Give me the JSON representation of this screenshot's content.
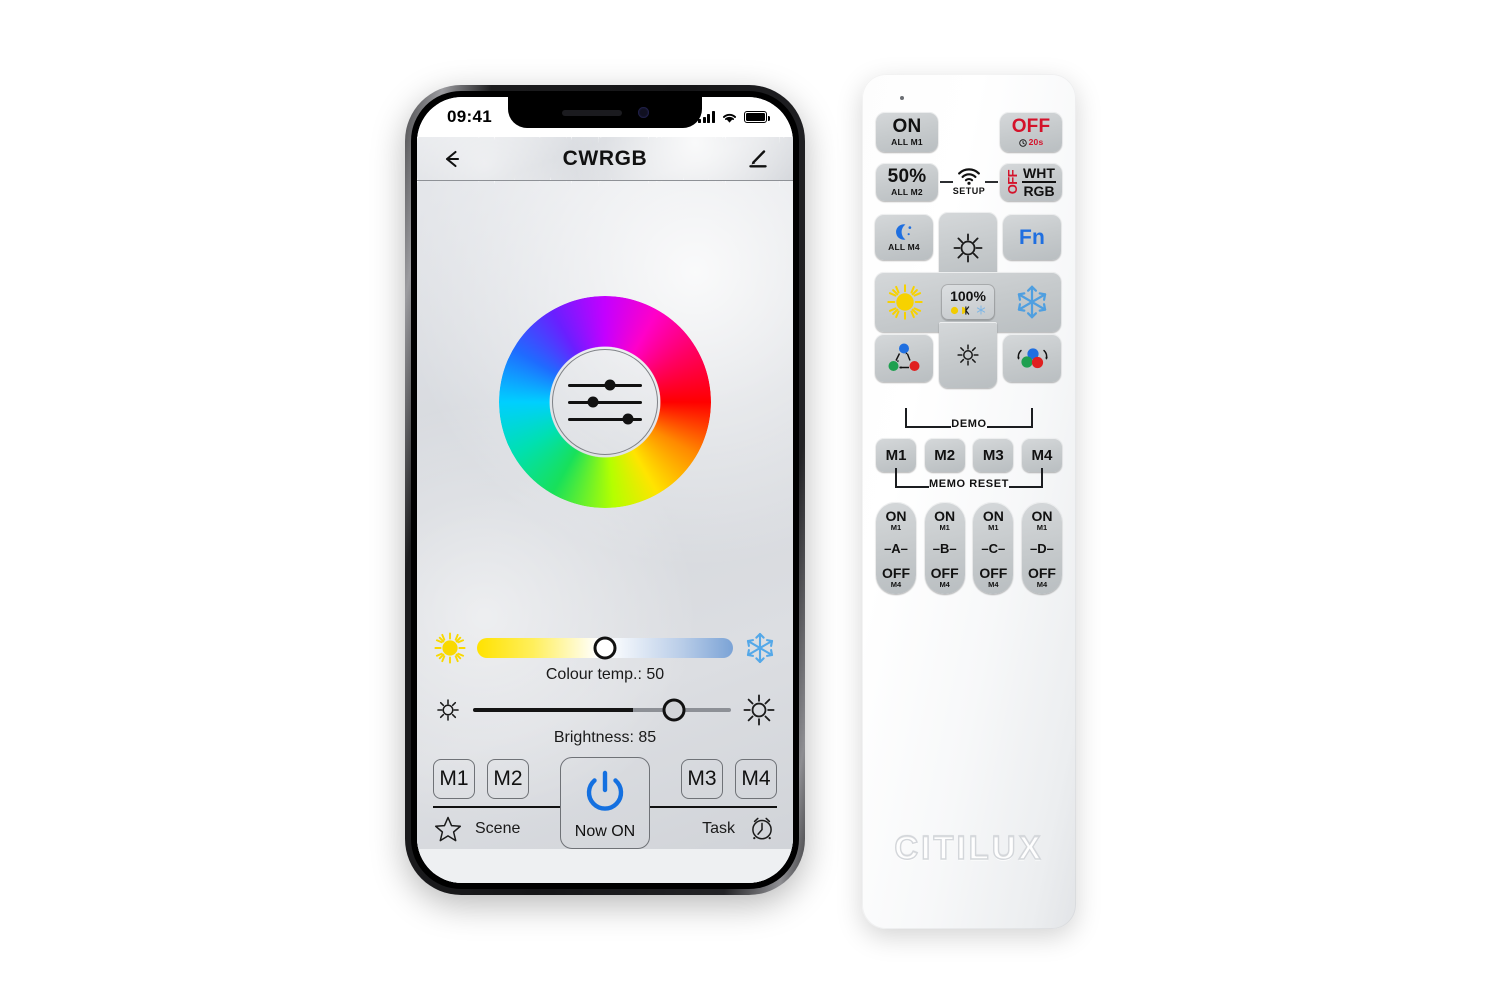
{
  "phone": {
    "status": {
      "time": "09:41",
      "signal_icon": "signal-bars-icon",
      "wifi_icon": "wifi-icon",
      "battery_icon": "battery-icon"
    },
    "header": {
      "back_icon": "back-arrow-icon",
      "title": "CWRGB",
      "edit_icon": "pencil-edit-icon"
    },
    "wheel": {
      "name": "colour-wheel",
      "center_icon": "sliders-icon"
    },
    "sliders": [
      {
        "id": "colour-temp",
        "left_icon": "warm-sun-icon",
        "right_icon": "snowflake-icon",
        "label": "Colour temp.: 50",
        "value": 50,
        "min": 0,
        "max": 100
      },
      {
        "id": "brightness",
        "left_icon": "low-brightness-icon",
        "right_icon": "high-brightness-icon",
        "label": "Brightness: 85",
        "value": 85,
        "min": 0,
        "max": 100
      }
    ],
    "memory_left": [
      "M1",
      "M2"
    ],
    "memory_right": [
      "M3",
      "M4"
    ],
    "power": {
      "icon": "power-icon",
      "label": "Now ON",
      "color": "#1470e0"
    },
    "scene": {
      "icon": "star-icon",
      "label": "Scene"
    },
    "task": {
      "icon": "alarm-clock-icon",
      "label": "Task"
    }
  },
  "remote": {
    "brand": "CITILUX",
    "row1": [
      {
        "name": "on-all-m1",
        "main": "ON",
        "sub": "ALL M1",
        "main_color": "#111111"
      },
      {
        "name": "off-20s",
        "main": "OFF",
        "sub": "20s",
        "main_color": "#d4122a",
        "sub_icon": "timer-icon"
      }
    ],
    "row2": {
      "left": {
        "name": "fifty-percent-all-m2",
        "main": "50%",
        "sub": "ALL M2"
      },
      "setup": {
        "name": "setup",
        "label": "SETUP",
        "icon": "wifi-signal-icon"
      },
      "right": {
        "name": "off-wht-rgb",
        "vertical": "OFF",
        "top": "WHT",
        "bottom": "RGB",
        "vertical_color": "#d4122a"
      }
    },
    "dpad": {
      "moon": {
        "name": "night-mode-all-m4",
        "icon": "moon-icon",
        "sub": "ALL M4"
      },
      "up": {
        "name": "brightness-up",
        "icon": "sun-icon"
      },
      "fn": {
        "name": "fn-button",
        "label": "Fn",
        "color": "#1f6fe0"
      },
      "left": {
        "name": "warm-white",
        "icon": "warm-sun-icon"
      },
      "right": {
        "name": "cool-white",
        "icon": "snowflake-icon"
      },
      "center": {
        "name": "hundred-percent",
        "label": "100%",
        "icons": [
          "warm-dot-icon",
          "kelvin-icon",
          "snowflake-small-icon"
        ]
      },
      "down": {
        "name": "brightness-down",
        "icon": "dim-sun-icon"
      },
      "demo_left": {
        "name": "demo-jump-mode",
        "icon": "rgb-jump-icon"
      },
      "demo_right": {
        "name": "demo-fade-mode",
        "icon": "rgb-fade-icon"
      }
    },
    "demo_label": "DEMO",
    "memo_label": "MEMO RESET",
    "memo": [
      "M1",
      "M2",
      "M3",
      "M4"
    ],
    "channels": [
      {
        "name": "channel-a",
        "on": "ON",
        "on_sub": "M1",
        "mid": "–A–",
        "off": "OFF",
        "off_sub": "M4"
      },
      {
        "name": "channel-b",
        "on": "ON",
        "on_sub": "M1",
        "mid": "–B–",
        "off": "OFF",
        "off_sub": "M4"
      },
      {
        "name": "channel-c",
        "on": "ON",
        "on_sub": "M1",
        "mid": "–C–",
        "off": "OFF",
        "off_sub": "M4"
      },
      {
        "name": "channel-d",
        "on": "ON",
        "on_sub": "M1",
        "mid": "–D–",
        "off": "OFF",
        "off_sub": "M4"
      }
    ]
  }
}
